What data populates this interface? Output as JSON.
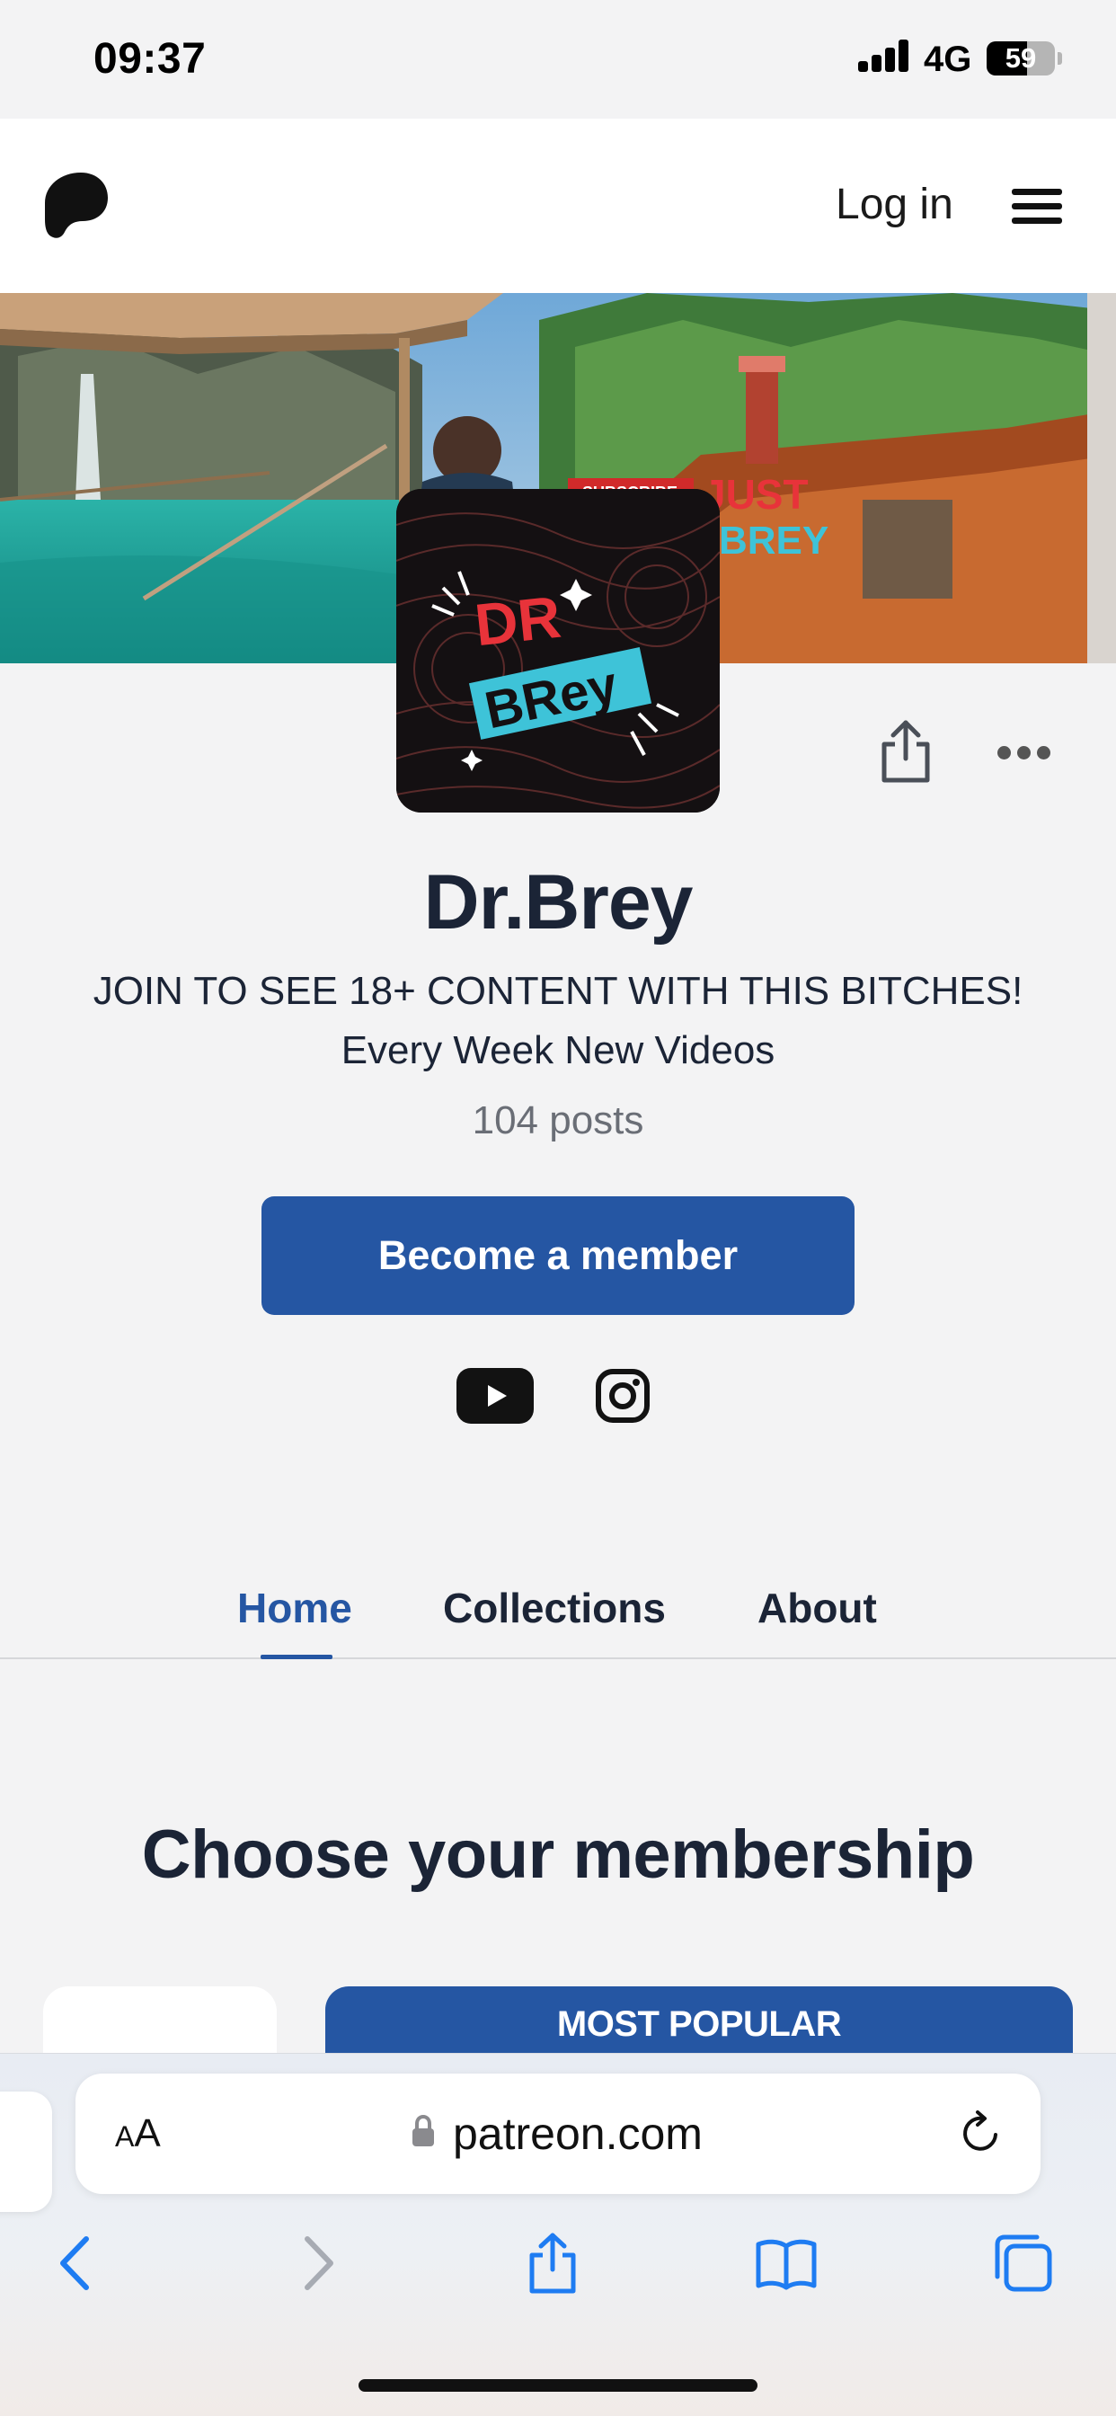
{
  "status_bar": {
    "time": "09:37",
    "network": "4G",
    "battery": "59",
    "battery_level": 0.59
  },
  "header": {
    "logo_icon": "patreon-logo-icon",
    "login_label": "Log in",
    "menu_icon": "hamburger-menu-icon"
  },
  "cover": {
    "sign_text": "SUBSCRIBE",
    "overlay_text_1": "JUST",
    "overlay_text_2": "BREY"
  },
  "avatar": {
    "line1": "DR",
    "line2": "BRey"
  },
  "creator": {
    "name": "Dr.Brey",
    "tagline_line1": "JOIN TO SEE 18+ CONTENT WITH THIS BITCHES!",
    "tagline_line2": "Every Week New Videos",
    "post_count": "104 posts"
  },
  "actions": {
    "share_icon": "share-icon",
    "more_icon": "more-options-icon",
    "member_button": "Become a member"
  },
  "social": [
    {
      "name": "youtube",
      "icon": "youtube-icon"
    },
    {
      "name": "instagram",
      "icon": "instagram-icon"
    }
  ],
  "tabs": [
    {
      "label": "Home",
      "active": true
    },
    {
      "label": "Collections",
      "active": false
    },
    {
      "label": "About",
      "active": false
    }
  ],
  "membership": {
    "title": "Choose your membership",
    "popular_label": "MOST POPULAR"
  },
  "browser": {
    "text_size_label_small": "A",
    "text_size_label_large": "A",
    "url": "patreon.com",
    "nav_icons": [
      "back-icon",
      "forward-icon",
      "share-icon",
      "bookmarks-icon",
      "tabs-icon"
    ]
  },
  "colors": {
    "accent": "#2556a3",
    "text": "#1b2436",
    "background": "#f3f3f4"
  }
}
